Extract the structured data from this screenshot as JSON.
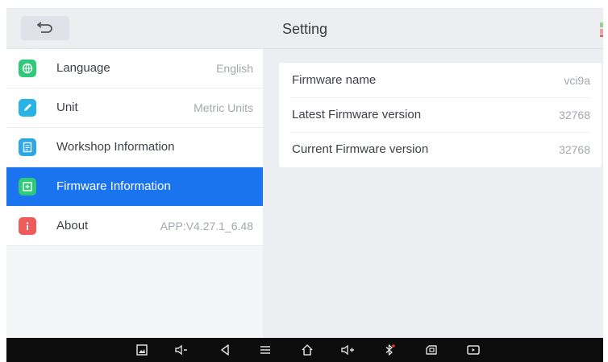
{
  "header": {
    "title": "Setting",
    "back_icon": "back-arrow-icon"
  },
  "sidebar": {
    "items": [
      {
        "label": "Language",
        "value": "English",
        "icon": "globe-icon",
        "color": "#2fc97a",
        "active": false
      },
      {
        "label": "Unit",
        "value": "Metric Units",
        "icon": "pencil-icon",
        "color": "#27b3e6",
        "active": false
      },
      {
        "label": "Workshop Information",
        "value": "",
        "icon": "document-icon",
        "color": "#2aa8e8",
        "active": false
      },
      {
        "label": "Firmware Information",
        "value": "",
        "icon": "firmware-icon",
        "color": "#2fc97a",
        "active": true
      },
      {
        "label": "About",
        "value": "APP:V4.27.1_6.48",
        "icon": "info-icon",
        "color": "#f05a5a",
        "active": false
      }
    ]
  },
  "firmware": {
    "rows": [
      {
        "label": "Firmware name",
        "value": "vci9a"
      },
      {
        "label": "Latest Firmware version",
        "value": "32768"
      },
      {
        "label": "Current Firmware version",
        "value": "32768"
      }
    ]
  },
  "navbar": {
    "icons": [
      "screenshot-icon",
      "volume-down-icon",
      "back-icon",
      "menu-icon",
      "home-icon",
      "volume-up-icon",
      "bluetooth-icon",
      "vci-icon",
      "screen-record-icon"
    ]
  },
  "colors": {
    "accent": "#1a74f0",
    "background": "#eceef2",
    "navbar": "#0c0c0c"
  }
}
